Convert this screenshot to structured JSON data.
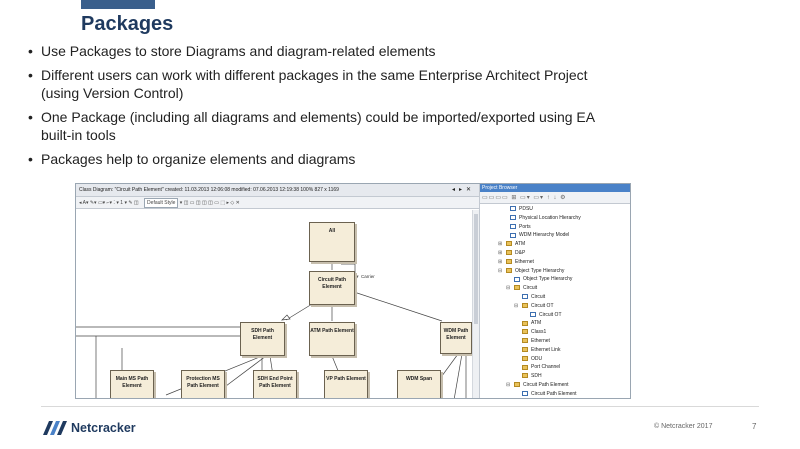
{
  "slide": {
    "title": "Packages",
    "bullets": [
      "Use Packages to store Diagrams and diagram-related elements",
      "Different users can work with different packages in the same Enterprise Architect Project (using Version Control)",
      "One Package (including all diagrams and elements) could be imported/exported using EA built-in tools",
      "Packages help to organize elements and diagrams"
    ],
    "copyright": "© Netcracker 2017",
    "page_number": "7",
    "logo_text": "Netcracker"
  },
  "diagram_window": {
    "title": "Class Diagram: \"Circuit Path Element\"   created: 11.03.2013 12:06:08  modified: 07.06.2013 12:19:38   100%   827 x 1169",
    "toolbar_style": "Default Style",
    "toolbar_zoom": "1",
    "boxes": {
      "all": "All",
      "circuit_path_element": "Circuit Path Element",
      "sdh_path_element": "SDH Path Element",
      "atm_path_element": "ATM Path Element",
      "wdm_path_element": "WDM Path Element",
      "main_ms_path_element": "Main MS Path Element",
      "protection_ms_path_element": "Protection MS Path Element",
      "sdh_end_point_path_element": "SDH End Point Path Element",
      "vp_path_element": "VP Path Element",
      "wdm_span": "WDM Span"
    },
    "carrier_label": "Carrier"
  },
  "project_browser": {
    "title": "Project Browser",
    "items": [
      {
        "label": "PDSU",
        "icon": "diagram-icon"
      },
      {
        "label": "Physical Location Hierarchy",
        "icon": "diagram-icon"
      },
      {
        "label": "Ports",
        "icon": "diagram-icon"
      },
      {
        "label": "WDM Hierarchy Model",
        "icon": "diagram-icon"
      },
      {
        "label": "ATM",
        "icon": "folder-icon"
      },
      {
        "label": "D&P",
        "icon": "folder-icon"
      },
      {
        "label": "Ethernet",
        "icon": "folder-icon"
      },
      {
        "label": "Object Type Hierarchy",
        "icon": "folder-icon"
      },
      {
        "label": "Object Type Hierarchy",
        "icon": "diagram-icon"
      },
      {
        "label": "Circuit",
        "icon": "folder-icon"
      },
      {
        "label": "Circuit",
        "icon": "diagram-icon"
      },
      {
        "label": "Circuit OT",
        "icon": "folder-icon"
      },
      {
        "label": "Circuit OT",
        "icon": "diagram-icon"
      },
      {
        "label": "ATM",
        "icon": "folder-icon"
      },
      {
        "label": "Class1",
        "icon": "folder-icon"
      },
      {
        "label": "Ethernet",
        "icon": "folder-icon"
      },
      {
        "label": "Ethernet Link",
        "icon": "folder-icon"
      },
      {
        "label": "ODU",
        "icon": "folder-icon"
      },
      {
        "label": "Port Channel",
        "icon": "folder-icon"
      },
      {
        "label": "SDH",
        "icon": "folder-icon"
      },
      {
        "label": "Circuit Path Element",
        "icon": "folder-icon"
      },
      {
        "label": "Circuit Path Element",
        "icon": "diagram-icon"
      }
    ]
  },
  "colors": {
    "title": "#1f3a5f",
    "accent_bar": "#3a5f8c",
    "box_fill": "#f5edd9",
    "browser_header": "#4a82c8"
  }
}
